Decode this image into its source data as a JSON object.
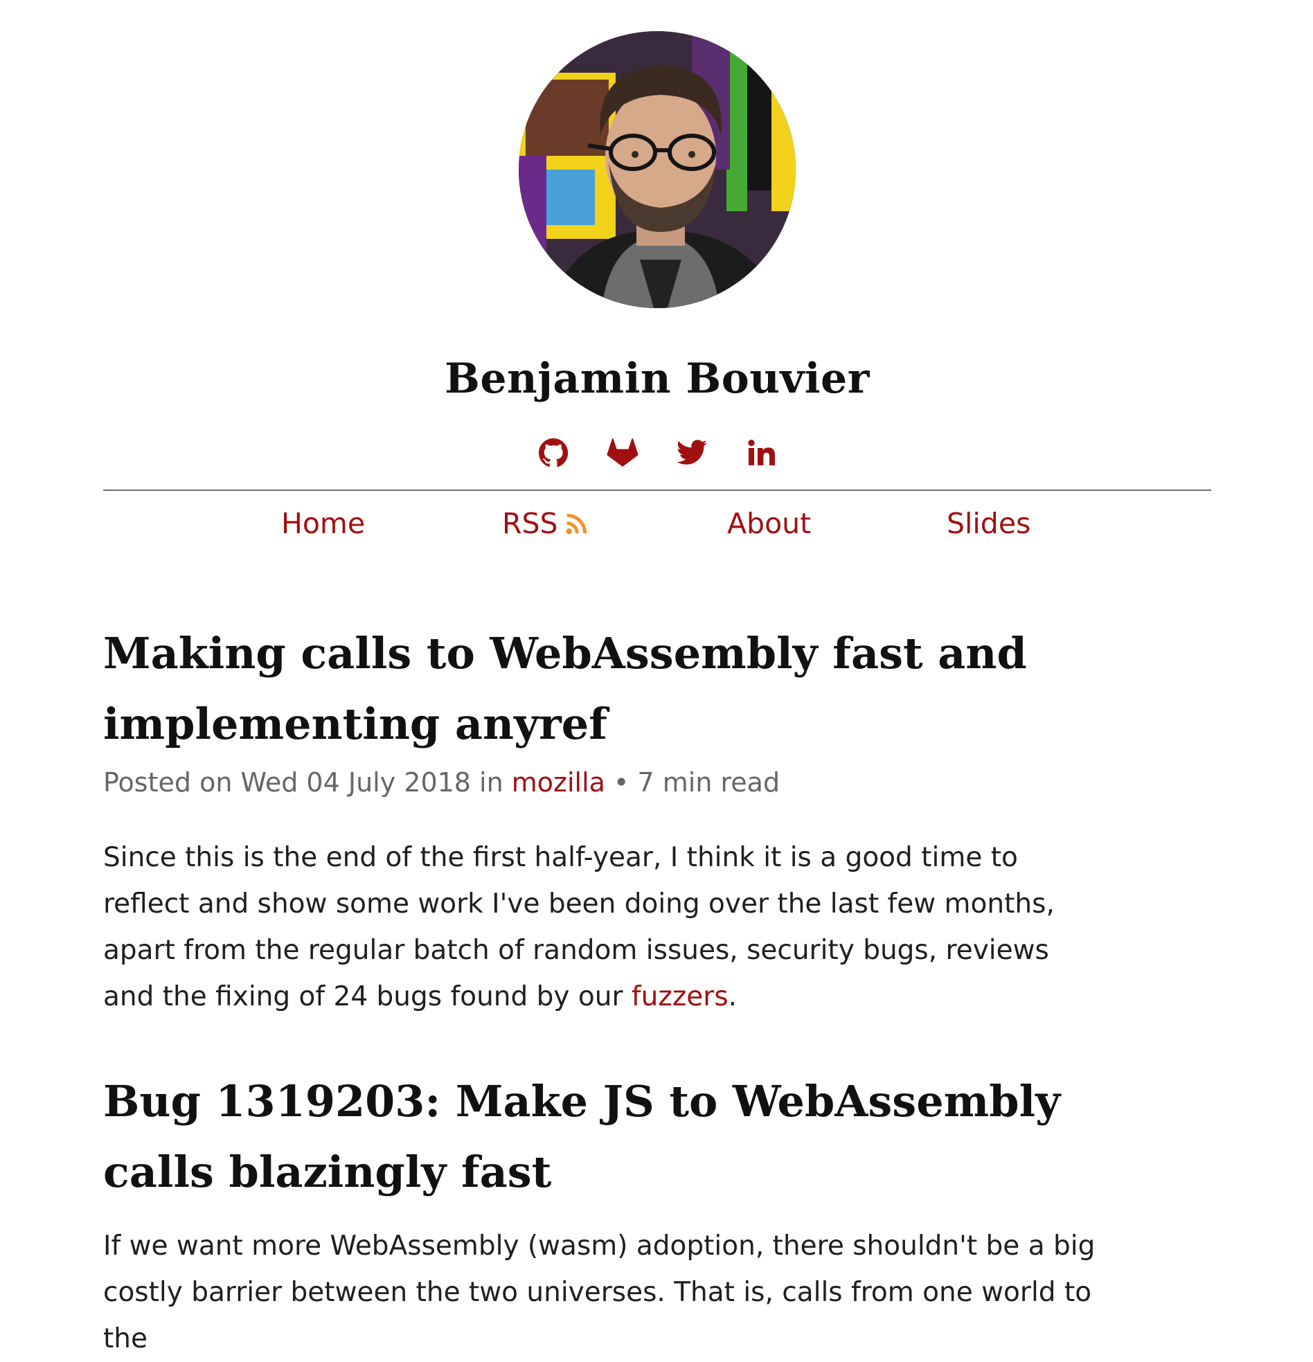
{
  "site": {
    "author": "Benjamin Bouvier"
  },
  "social": [
    {
      "name": "github-icon"
    },
    {
      "name": "gitlab-icon"
    },
    {
      "name": "twitter-icon"
    },
    {
      "name": "linkedin-icon"
    }
  ],
  "nav": {
    "home": "Home",
    "rss": "RSS",
    "about": "About",
    "slides": "Slides"
  },
  "post": {
    "title": "Making calls to WebAssembly fast and implementing anyref",
    "meta_prefix": "Posted on Wed 04 July 2018 in ",
    "category": "mozilla",
    "meta_suffix": " • 7 min read",
    "intro_before_link": "Since this is the end of the first half-year, I think it is a good time to reflect and show some work I've been doing over the last few months, apart from the regular batch of random issues, security bugs, reviews and the fixing of 24 bugs found by our ",
    "intro_link": "fuzzers",
    "intro_after_link": ".",
    "section1_title": "Bug 1319203: Make JS to WebAssembly calls blazingly fast",
    "section1_para": "If we want more WebAssembly (wasm) adoption, there shouldn't be a big costly barrier between the two universes. That is, calls from one world to the"
  },
  "colors": {
    "accent": "#a01010",
    "rss_orange": "#f0922a",
    "text": "#1f1f1f",
    "meta": "#666666",
    "divider": "#6e6e6e"
  }
}
